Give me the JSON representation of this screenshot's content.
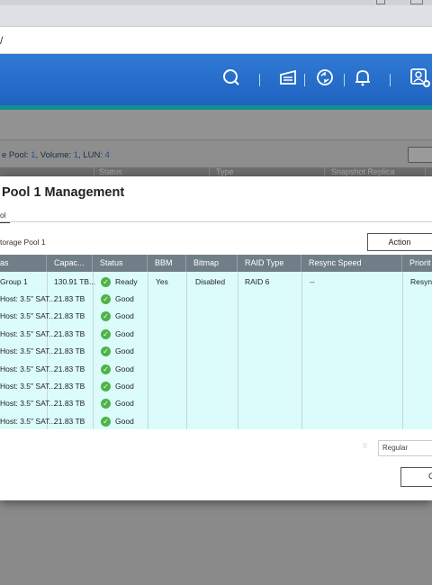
{
  "browser": {
    "url_fragment": "/"
  },
  "header": {
    "icons": [
      "search-icon",
      "task-list-icon",
      "sync-icon",
      "bell-icon",
      "user-icon"
    ]
  },
  "background_app": {
    "info_prefix": "e Pool: ",
    "pool_count": "1",
    "volume_label": ", Volume: ",
    "volume_count": "1",
    "lun_label": ", LUN: ",
    "lun_count": "4",
    "headers": [
      "Status",
      "Type",
      "Snapshot Replica"
    ]
  },
  "modal": {
    "title": "Pool 1 Management",
    "tab": "ol",
    "breadcrumb": "torage Pool 1",
    "action_label": "Action",
    "columns": [
      "as",
      "Capac...",
      "Status",
      "BBM",
      "Bitmap",
      "RAID Type",
      "Resync Speed",
      "Priorit"
    ],
    "rows": [
      {
        "name": "Group 1",
        "capacity": "130.91 TB...",
        "status": "Ready",
        "bbm": "Yes",
        "bitmap": "Disabled",
        "raid": "RAID 6",
        "resync": "--",
        "priority": "Resync"
      },
      {
        "name": "Host: 3.5\" SAT...",
        "capacity": "21.83 TB",
        "status": "Good"
      },
      {
        "name": "Host: 3.5\" SAT...",
        "capacity": "21.83 TB",
        "status": "Good"
      },
      {
        "name": "Host: 3.5\" SAT...",
        "capacity": "21.83 TB",
        "status": "Good"
      },
      {
        "name": "Host: 3.5\" SAT...",
        "capacity": "21.83 TB",
        "status": "Good"
      },
      {
        "name": "Host: 3.5\" SAT...",
        "capacity": "21.83 TB",
        "status": "Good"
      },
      {
        "name": "Host: 3.5\" SAT...",
        "capacity": "21.83 TB",
        "status": "Good"
      },
      {
        "name": "Host: 3.5\" SAT...",
        "capacity": "21.83 TB",
        "status": "Good"
      },
      {
        "name": "Host: 3.5\" SAT...",
        "capacity": "21.83 TB",
        "status": "Good"
      }
    ],
    "footer_select": "Regular",
    "close_label": "Close"
  },
  "colors": {
    "header_blue": "#2f7ad6",
    "stripe_teal": "#0f8f8f",
    "table_header": "#707e88",
    "row_bg": "#dcfcfc",
    "status_ok": "#4eb348"
  }
}
